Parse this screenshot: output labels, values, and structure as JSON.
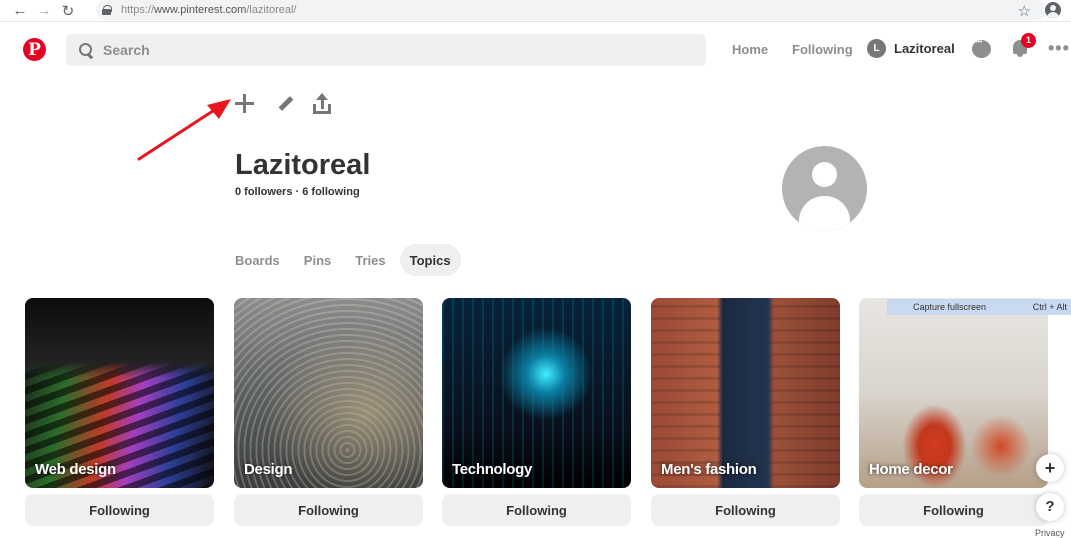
{
  "browser": {
    "url_scheme": "https://",
    "url_host": "www.pinterest.com",
    "url_path": "/lazitoreal/"
  },
  "header": {
    "logo": "P",
    "search_placeholder": "Search",
    "nav": {
      "home": "Home",
      "following": "Following"
    },
    "profile_initial": "L",
    "profile_name": "Lazitoreal",
    "notification_count": "1",
    "colors": {
      "brand": "#e60023"
    }
  },
  "profile": {
    "name": "Lazitoreal",
    "stats": "0 followers · 6 following"
  },
  "tabs": [
    "Boards",
    "Pins",
    "Tries",
    "Topics"
  ],
  "active_tab": "Topics",
  "topics": [
    {
      "label": "Web design",
      "button": "Following"
    },
    {
      "label": "Design",
      "button": "Following"
    },
    {
      "label": "Technology",
      "button": "Following"
    },
    {
      "label": "Men's fashion",
      "button": "Following"
    },
    {
      "label": "Home decor",
      "button": "Following"
    }
  ],
  "tooltip": {
    "action": "Capture fullscreen",
    "shortcut": "Ctrl + Alt"
  },
  "fabs": {
    "add": "+",
    "help": "?"
  },
  "footer": {
    "privacy": "Privacy"
  }
}
